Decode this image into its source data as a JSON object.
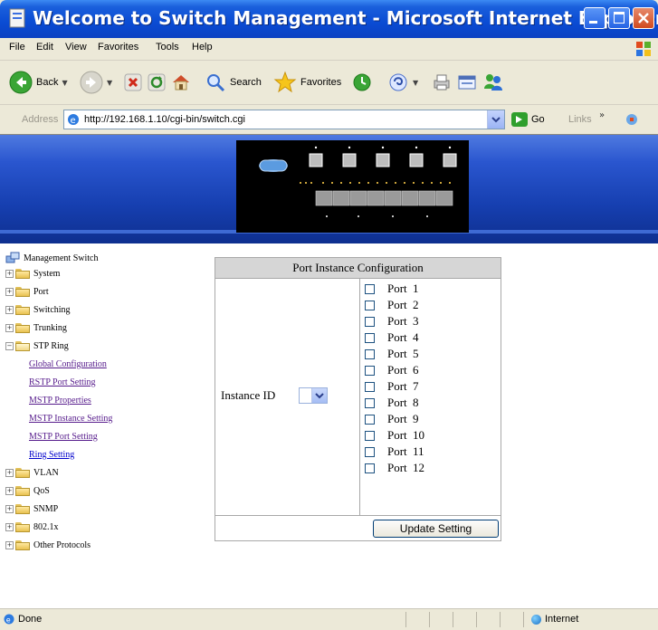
{
  "window": {
    "title": "Welcome to Switch Management - Microsoft Internet Explorer"
  },
  "menu": [
    "File",
    "Edit",
    "View",
    "Favorites",
    "Tools",
    "Help"
  ],
  "toolbar": {
    "back_label": "Back",
    "search_label": "Search",
    "favorites_label": "Favorites"
  },
  "address": {
    "label": "Address",
    "url": "http://192.168.1.10/cgi-bin/switch.cgi",
    "go_label": "Go",
    "links_label": "Links"
  },
  "tree": {
    "root": "Management Switch",
    "items": [
      {
        "label": "System"
      },
      {
        "label": "Port"
      },
      {
        "label": "Switching"
      },
      {
        "label": "Trunking"
      },
      {
        "label": "STP  Ring"
      },
      {
        "label": "Global Configuration"
      },
      {
        "label": "RSTP Port Setting"
      },
      {
        "label": "MSTP Properties"
      },
      {
        "label": "MSTP Instance Setting"
      },
      {
        "label": "MSTP Port Setting"
      },
      {
        "label": "Ring Setting"
      },
      {
        "label": "VLAN"
      },
      {
        "label": "QoS"
      },
      {
        "label": "SNMP"
      },
      {
        "label": "802.1x"
      },
      {
        "label": "Other Protocols"
      }
    ]
  },
  "config": {
    "title": "Port Instance Configuration",
    "instance_label": "Instance ID",
    "instance_value": "",
    "port_word": "Port",
    "ports": [
      "1",
      "2",
      "3",
      "4",
      "5",
      "6",
      "7",
      "8",
      "9",
      "10",
      "11",
      "12"
    ],
    "update_label": "Update Setting"
  },
  "status": {
    "text": "Done",
    "zone": "Internet"
  },
  "colors": {
    "titlebar": "#0a4bd3",
    "banner": "#163fb0",
    "link_visited": "#551a8b",
    "table_header": "#d6d6d6"
  }
}
